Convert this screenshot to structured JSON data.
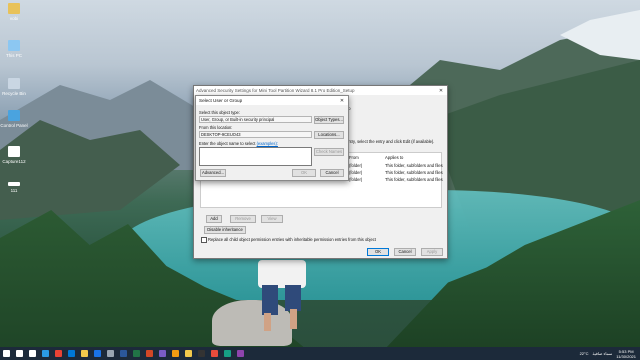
{
  "desktop": {
    "icons": [
      {
        "label": "vobi",
        "icon": "user-folder-icon",
        "color": "#e8c25a"
      },
      {
        "label": "This PC",
        "icon": "computer-icon",
        "color": "#8cc7f2"
      },
      {
        "label": "Recycle Bin",
        "icon": "recycle-bin-icon",
        "color": "#c9d6e3"
      },
      {
        "label": "Control Panel",
        "icon": "control-panel-icon",
        "color": "#4aa3df"
      },
      {
        "label": "Capture112",
        "icon": "image-file-icon",
        "color": "#ffffff"
      },
      {
        "label": "111",
        "icon": "file-icon",
        "color": "#ffffff"
      }
    ]
  },
  "adv_window": {
    "title": "Advanced Security Settings for Mini Tool Partition Wizard 8.1 Pro Edition_Setup",
    "close": "✕",
    "header_frag": "up",
    "instr_frag": "entry, select the entry and click Edit (if available).",
    "columns": {
      "from": "From",
      "applies": "Applies to"
    },
    "rows": [
      {
        "from": "(folder)",
        "applies": "This folder, subfolders and files"
      },
      {
        "from": "(folder)",
        "applies": "This folder, subfolders and files"
      },
      {
        "from": "(folder)",
        "applies": "This folder, subfolders and files"
      }
    ],
    "buttons": {
      "add": "Add",
      "remove": "Remove",
      "view": "View",
      "disable_inheritance": "Disable inheritance",
      "ok": "OK",
      "cancel": "Cancel",
      "apply": "Apply"
    },
    "replace_checkbox": "Replace all child object permission entries with inheritable permission entries from this object"
  },
  "dialog": {
    "title": "Select User or Group",
    "close": "✕",
    "object_type_label": "Select this object type:",
    "object_type_value": "User, Group, or Built-in security principal",
    "object_types_btn": "Object Types...",
    "location_label": "From this location:",
    "location_value": "DESKTOP-9CEUO43",
    "locations_btn": "Locations...",
    "enter_label": "Enter the object name to select ",
    "examples_link": "(examples):",
    "check_names_btn": "Check Names",
    "advanced_btn": "Advanced...",
    "ok_btn": "OK",
    "cancel_btn": "Cancel"
  },
  "taskbar": {
    "apps": [
      {
        "icon": "windows-start-icon",
        "color": "#ffffff"
      },
      {
        "icon": "search-icon",
        "color": "#ffffff"
      },
      {
        "icon": "task-view-icon",
        "color": "#ffffff"
      },
      {
        "icon": "edge-icon",
        "color": "#2b9be6"
      },
      {
        "icon": "chrome-icon",
        "color": "#e94335"
      },
      {
        "icon": "store-icon",
        "color": "#0078d7"
      },
      {
        "icon": "file-explorer-icon",
        "color": "#f2c94c"
      },
      {
        "icon": "mail-icon",
        "color": "#1a73e8"
      },
      {
        "icon": "settings-icon",
        "color": "#9aa6b2"
      },
      {
        "icon": "word-icon",
        "color": "#2b579a"
      },
      {
        "icon": "excel-icon",
        "color": "#217346"
      },
      {
        "icon": "powerpoint-icon",
        "color": "#d24726"
      },
      {
        "icon": "photos-icon",
        "color": "#7a5cc6"
      },
      {
        "icon": "vlc-icon",
        "color": "#f39c12"
      },
      {
        "icon": "folder-icon",
        "color": "#f2c94c"
      },
      {
        "icon": "terminal-icon",
        "color": "#333333"
      },
      {
        "icon": "snip-icon",
        "color": "#e74c3c"
      },
      {
        "icon": "app-icon",
        "color": "#16a085"
      },
      {
        "icon": "app2-icon",
        "color": "#8e44ad"
      }
    ],
    "weather": "22°C",
    "weather_desc": "سماء صافية",
    "time": "5:53 PM",
    "date": "11/30/2021"
  }
}
